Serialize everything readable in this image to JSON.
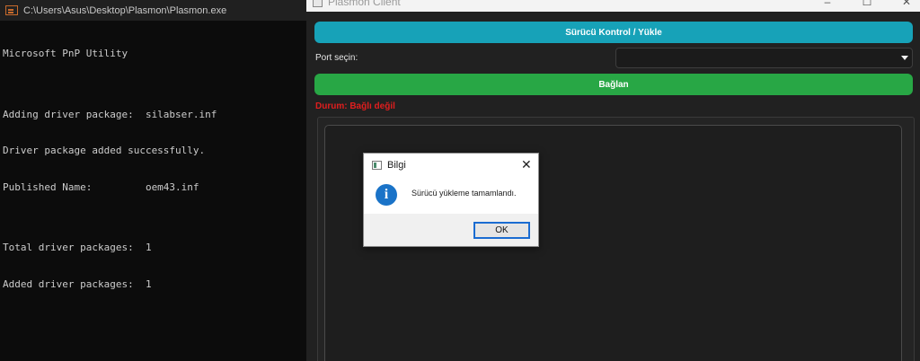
{
  "console": {
    "title": "C:\\Users\\Asus\\Desktop\\Plasmon\\Plasmon.exe",
    "lines": [
      "Microsoft PnP Utility",
      "",
      "Adding driver package:  silabser.inf",
      "Driver package added successfully.",
      "Published Name:         oem43.inf",
      "",
      "Total driver packages:  1",
      "Added driver packages:  1"
    ]
  },
  "client": {
    "title": "Plasmon Client",
    "controls": {
      "minimize": "–",
      "maximize": "☐",
      "close": "✕"
    },
    "driver_button": "Sürücü Kontrol / Yükle",
    "port_label": "Port seçin:",
    "port_value": "",
    "connect_button": "Bağlan",
    "status": "Durum: Bağlı değil",
    "colors": {
      "driver_button": "#17a2b8",
      "connect_button": "#28a745",
      "status": "#e01e1e"
    }
  },
  "dialog": {
    "title": "Bilgi",
    "close": "✕",
    "icon": "info-icon",
    "icon_glyph": "i",
    "message": "Sürücü yükleme tamamlandı.",
    "ok_button": "OK"
  }
}
